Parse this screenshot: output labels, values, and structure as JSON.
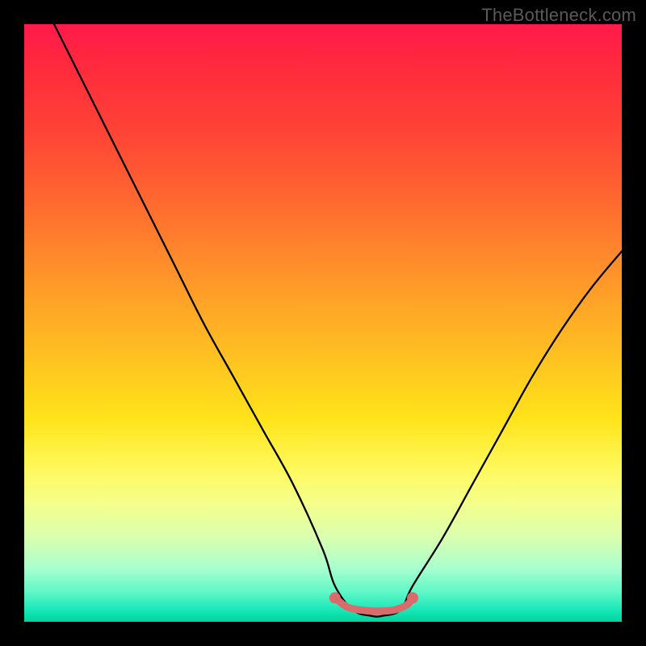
{
  "watermark": "TheBottleneck.com",
  "chart_data": {
    "type": "line",
    "title": "",
    "xlabel": "",
    "ylabel": "",
    "xlim": [
      0,
      100
    ],
    "ylim": [
      0,
      100
    ],
    "series": [
      {
        "name": "bottleneck-curve",
        "x": [
          5,
          10,
          15,
          20,
          25,
          30,
          35,
          40,
          45,
          50,
          52,
          55,
          58,
          60,
          63,
          65,
          70,
          75,
          80,
          85,
          90,
          95,
          100
        ],
        "y": [
          100,
          90,
          80,
          70,
          60,
          50,
          41,
          32,
          23,
          12,
          6,
          2,
          1,
          1,
          2,
          6,
          14,
          23,
          32,
          41,
          49,
          56,
          62
        ]
      },
      {
        "name": "flat-highlight",
        "x": [
          52,
          54,
          56,
          58,
          60,
          62,
          64,
          65
        ],
        "y": [
          4,
          2.5,
          2,
          1.8,
          1.8,
          2,
          2.8,
          4
        ]
      }
    ],
    "colors": {
      "curve": "#000000",
      "highlight": "#d96b6b",
      "gradient_top": "#ff1a4b",
      "gradient_bottom": "#00d39a"
    }
  }
}
